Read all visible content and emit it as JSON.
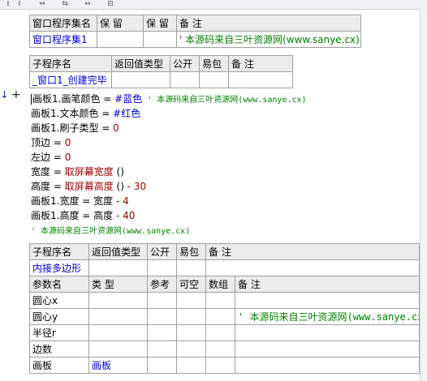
{
  "toolbar": {
    "icons": [
      "download-icon",
      "upload-icon",
      "expand-icon",
      "collapse-icon",
      "fit-icon",
      "layout-icon"
    ]
  },
  "assembly_table": {
    "headers": [
      "窗口程序集名",
      "保 留",
      "保 留",
      "备 注"
    ],
    "row": {
      "name": "窗口程序集1",
      "reserve1": "",
      "reserve2": "",
      "note": "' 本源码来自三叶资源网(www.sanye.cx)"
    }
  },
  "sub1_table": {
    "headers": [
      "子程序名",
      "返回值类型",
      "公开",
      "易包",
      "备 注"
    ],
    "row": {
      "name": "_窗口1_创建完毕",
      "return_type": "",
      "public": "",
      "easy_pack": "",
      "note": ""
    }
  },
  "gutter": {
    "plus": "+"
  },
  "code": {
    "l1": {
      "a": "画板1.画笔颜色",
      "b": " = ",
      "c": "#蓝色",
      "d": "  ' 本源码来自三叶资源网(www.sanye.cx)"
    },
    "l2": {
      "a": "画板1.文本颜色",
      "b": " = ",
      "c": "#红色"
    },
    "l3": {
      "a": "画板1.刷子类型",
      "b": " = ",
      "c": "0"
    },
    "l4": {
      "a": "顶边",
      "b": " = ",
      "c": "0"
    },
    "l5": {
      "a": "左边",
      "b": " = ",
      "c": "0"
    },
    "l6": {
      "a": "宽度",
      "b": " = ",
      "c": "取屏幕宽度",
      "d": " ()"
    },
    "l7": {
      "a": "高度",
      "b": " = ",
      "c": "取屏幕高度",
      "d": " () ",
      "e": "- 30"
    },
    "l8": {
      "a": "画板1.宽度",
      "b": " = ",
      "c": "宽度",
      "d": " - 4"
    },
    "l9": {
      "a": "画板1.高度",
      "b": " = ",
      "c": "高度",
      "d": " - 40"
    },
    "l10": {
      "a": "' 本源码来自三叶资源网(www.sanye.cx)"
    }
  },
  "sub2_table": {
    "headers": [
      "子程序名",
      "返回值类型",
      "公开",
      "易包",
      "备 注"
    ],
    "row": {
      "name": "内接多边形",
      "return_type": "",
      "public": "",
      "easy_pack": "",
      "note": ""
    },
    "param_headers": [
      "参数名",
      "类 型",
      "参考",
      "可空",
      "数组",
      "备 注"
    ],
    "params": [
      {
        "name": "圆心x",
        "type": "",
        "ref": "",
        "nullable": "",
        "array": "",
        "note": ""
      },
      {
        "name": "圆心y",
        "type": "",
        "ref": "",
        "nullable": "",
        "array": "",
        "note": "' 本源码来自三叶资源网(www.sanye.cx)"
      },
      {
        "name": "半径r",
        "type": "",
        "ref": "",
        "nullable": "",
        "array": "",
        "note": ""
      },
      {
        "name": "边数",
        "type": "",
        "ref": "",
        "nullable": "",
        "array": "",
        "note": ""
      },
      {
        "name": "画板",
        "type": "画板",
        "ref": "",
        "nullable": "",
        "array": "",
        "note": ""
      }
    ]
  }
}
